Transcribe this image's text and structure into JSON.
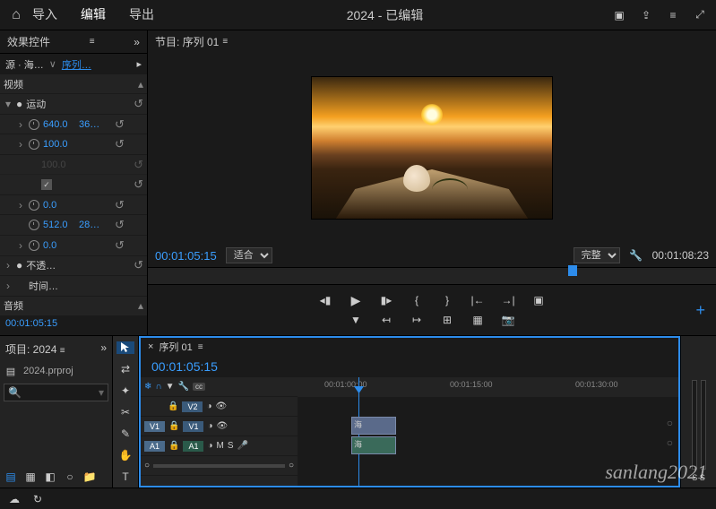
{
  "topbar": {
    "home": "⌂",
    "import": "导入",
    "edit": "编辑",
    "export": "导出",
    "title": "2024 - 已编辑"
  },
  "fx": {
    "panel_title": "效果控件",
    "source_prefix": "源 · 海…",
    "sequence": "序列…",
    "video_header": "视频",
    "motion": "运动",
    "opacity": "不透…",
    "time": "时间…",
    "audio_header": "音频",
    "params": [
      {
        "v1": "640.0",
        "v2": "36…"
      },
      {
        "v1": "100.0",
        "v2": ""
      },
      {
        "v1": "100.0",
        "v2": "",
        "dim": true
      },
      {
        "v1": "chk",
        "v2": ""
      },
      {
        "v1": "0.0",
        "v2": ""
      },
      {
        "v1": "512.0",
        "v2": "28…"
      },
      {
        "v1": "0.0",
        "v2": ""
      }
    ],
    "timecode": "00:01:05:15"
  },
  "program": {
    "header": "节目: 序列 01",
    "timecode": "00:01:05:15",
    "fit": "适合",
    "quality": "完整",
    "duration": "00:01:08:23"
  },
  "project": {
    "title": "项目: 2024",
    "file": "2024.prproj"
  },
  "timeline": {
    "tab": "序列 01",
    "timecode": "00:01:05:15",
    "marks": [
      "00:01:00:00",
      "00:01:15:00",
      "00:01:30:00"
    ],
    "tracks": {
      "v2": "V2",
      "v1": "V1",
      "a1": "A1",
      "v1src": "V1",
      "a1src": "A1",
      "m": "M",
      "s": "S"
    },
    "clip": "海"
  },
  "audio_meters": {
    "s1": "S",
    "s2": "S"
  },
  "watermark": "sanlang2021"
}
